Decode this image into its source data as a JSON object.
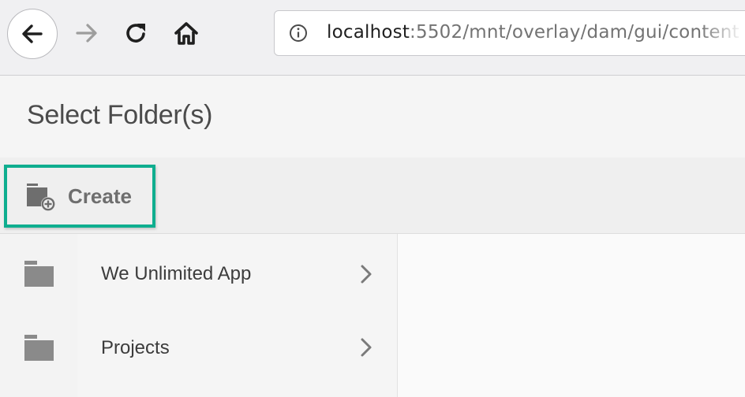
{
  "browser": {
    "url_host": "localhost",
    "url_path": ":5502/mnt/overlay/dam/gui/content",
    "icons": [
      "back-arrow-icon",
      "forward-arrow-icon",
      "reload-icon",
      "home-icon",
      "info-icon"
    ]
  },
  "dialog": {
    "title": "Select Folder(s)"
  },
  "toolbar": {
    "create_label": "Create",
    "highlight_color": "#0fae8f"
  },
  "folders": [
    {
      "label": "We Unlimited App"
    },
    {
      "label": "Projects"
    }
  ]
}
